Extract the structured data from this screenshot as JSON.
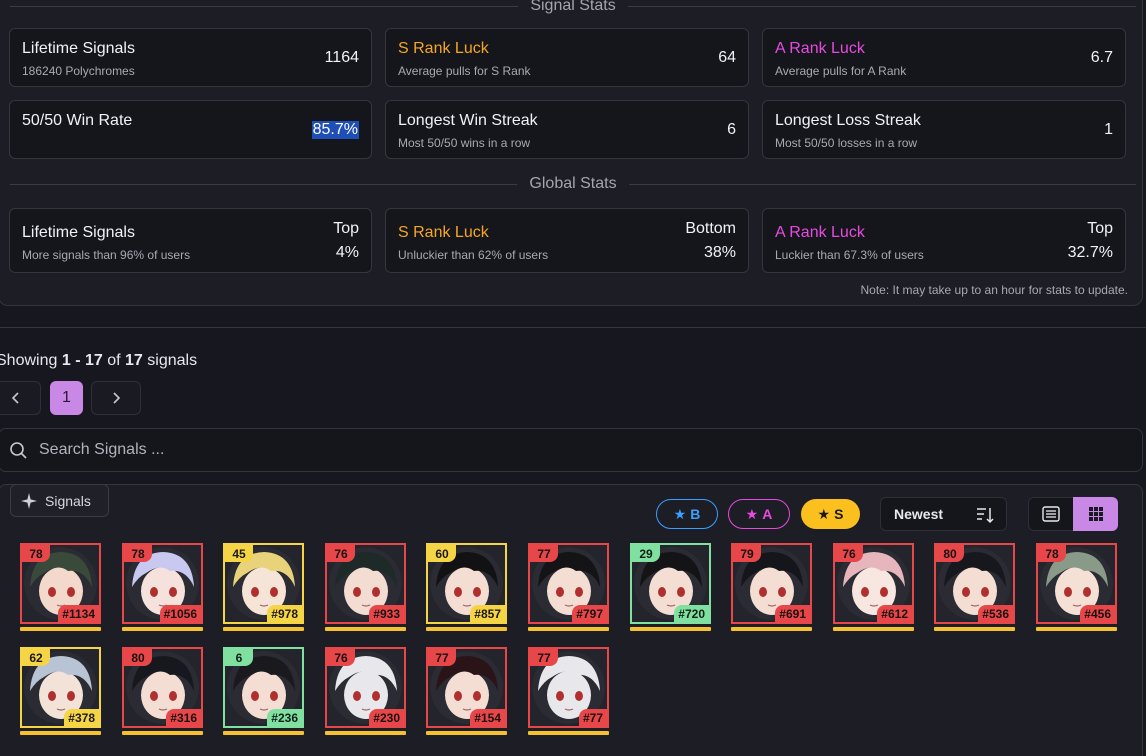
{
  "signal_stats": {
    "heading": "Signal Stats",
    "cards": [
      {
        "title": "Lifetime Signals",
        "subtitle": "186240 Polychromes",
        "value": "1164"
      },
      {
        "title": "S Rank Luck",
        "subtitle": "Average pulls for S Rank",
        "value": "64"
      },
      {
        "title": "A Rank Luck",
        "subtitle": "Average pulls for A Rank",
        "value": "6.7"
      },
      {
        "title": "50/50 Win Rate",
        "subtitle": "",
        "value": "85.7%"
      },
      {
        "title": "Longest Win Streak",
        "subtitle": "Most 50/50 wins in a row",
        "value": "6"
      },
      {
        "title": "Longest Loss Streak",
        "subtitle": "Most 50/50 losses in a row",
        "value": "1"
      }
    ]
  },
  "global_stats": {
    "heading": "Global Stats",
    "cards": [
      {
        "title": "Lifetime Signals",
        "subtitle": "More signals than 96% of users",
        "rank": "Top",
        "value": "4%"
      },
      {
        "title": "S Rank Luck",
        "subtitle": "Unluckier than 62% of users",
        "rank": "Bottom",
        "value": "38%"
      },
      {
        "title": "A Rank Luck",
        "subtitle": "Luckier than 67.3% of users",
        "rank": "Top",
        "value": "32.7%"
      }
    ],
    "note": "Note: It may take up to an hour for stats to update."
  },
  "pagination": {
    "showing_prefix": "Showing",
    "from": "1",
    "dash": "-",
    "to": "17",
    "of": "of",
    "total": "17",
    "suffix": "signals",
    "current_page": "1"
  },
  "search": {
    "placeholder": "Search Signals ..."
  },
  "filters": {
    "tag_label": "Signals",
    "chip_b": "B",
    "chip_a": "A",
    "chip_s": "S",
    "sort_label": "Newest"
  },
  "colors": {
    "accent": "#c987e6",
    "s_rank": "#f5a623",
    "a_rank": "#e84ae0",
    "b_rank": "#3aa0ff",
    "bad_luck": "#e8474a",
    "mid_luck": "#f5d445",
    "good_luck": "#7fe0a0"
  },
  "signals": [
    {
      "pulls": "78",
      "number": "#1134",
      "luck": "r",
      "hair": "#3a4a3a",
      "skin": "#f3d9cc"
    },
    {
      "pulls": "78",
      "number": "#1056",
      "luck": "r",
      "hair": "#c8c8f0",
      "skin": "#f6e2dc"
    },
    {
      "pulls": "45",
      "number": "#978",
      "luck": "y",
      "hair": "#e8d27a",
      "skin": "#f6e4d6"
    },
    {
      "pulls": "76",
      "number": "#933",
      "luck": "r",
      "hair": "#1e2a28",
      "skin": "#f3dcd2"
    },
    {
      "pulls": "60",
      "number": "#857",
      "luck": "y",
      "hair": "#121214",
      "skin": "#f4ddd2"
    },
    {
      "pulls": "77",
      "number": "#797",
      "luck": "r",
      "hair": "#141416",
      "skin": "#f4ddd2"
    },
    {
      "pulls": "29",
      "number": "#720",
      "luck": "g",
      "hair": "#141416",
      "skin": "#f4ddd2"
    },
    {
      "pulls": "79",
      "number": "#691",
      "luck": "r",
      "hair": "#15161c",
      "skin": "#f4ddd2"
    },
    {
      "pulls": "76",
      "number": "#612",
      "luck": "r",
      "hair": "#e6b6bc",
      "skin": "#f8e6e0"
    },
    {
      "pulls": "80",
      "number": "#536",
      "luck": "r",
      "hair": "#17181e",
      "skin": "#f4ddd2"
    },
    {
      "pulls": "78",
      "number": "#456",
      "luck": "r",
      "hair": "#8a9a88",
      "skin": "#f4e0d4"
    },
    {
      "pulls": "62",
      "number": "#378",
      "luck": "y",
      "hair": "#b8c4d4",
      "skin": "#f2e2d8"
    },
    {
      "pulls": "80",
      "number": "#316",
      "luck": "r",
      "hair": "#17181e",
      "skin": "#f4ddd2"
    },
    {
      "pulls": "6",
      "number": "#236",
      "luck": "g",
      "hair": "#1a1a1e",
      "skin": "#f4ddd2"
    },
    {
      "pulls": "76",
      "number": "#230",
      "luck": "r",
      "hair": "#e8e8ec",
      "skin": "#e8e8ec"
    },
    {
      "pulls": "77",
      "number": "#154",
      "luck": "r",
      "hair": "#2a1418",
      "skin": "#f4ddd2"
    },
    {
      "pulls": "77",
      "number": "#77",
      "luck": "r",
      "hair": "#e8e8ec",
      "skin": "#e8e8ec"
    }
  ]
}
